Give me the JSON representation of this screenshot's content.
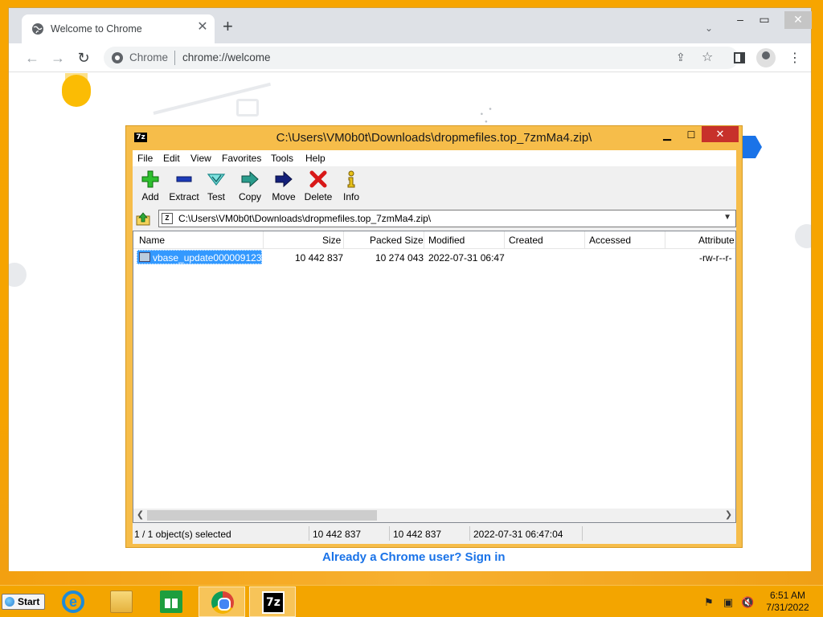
{
  "chrome": {
    "tab_title": "Welcome to Chrome",
    "site_label": "Chrome",
    "url": "chrome://welcome",
    "signin_text": "Already a Chrome user? Sign in"
  },
  "sevenzip": {
    "app_icon": "7z",
    "title": "C:\\Users\\VM0b0t\\Downloads\\dropmefiles.top_7zmMa4.zip\\",
    "menu": [
      "File",
      "Edit",
      "View",
      "Favorites",
      "Tools",
      "Help"
    ],
    "toolbar": {
      "add": "Add",
      "extract": "Extract",
      "test": "Test",
      "copy": "Copy",
      "move": "Move",
      "delete": "Delete",
      "info": "Info"
    },
    "address": "C:\\Users\\VM0b0t\\Downloads\\dropmefiles.top_7zmMa4.zip\\",
    "columns": {
      "name": "Name",
      "size": "Size",
      "packed": "Packed Size",
      "modified": "Modified",
      "created": "Created",
      "accessed": "Accessed",
      "attributes": "Attribute"
    },
    "rows": [
      {
        "name": "vbase_update000009123...",
        "size": "10 442 837",
        "packed": "10 274 043",
        "modified": "2022-07-31 06:47",
        "created": "",
        "accessed": "",
        "attributes": "-rw-r--r-"
      }
    ],
    "status": {
      "selected": "1 / 1 object(s) selected",
      "size": "10 442 837",
      "packed": "10 442 837",
      "modified": "2022-07-31 06:47:04"
    }
  },
  "taskbar": {
    "start_label": "Start",
    "time": "6:51 AM",
    "date": "7/31/2022"
  }
}
